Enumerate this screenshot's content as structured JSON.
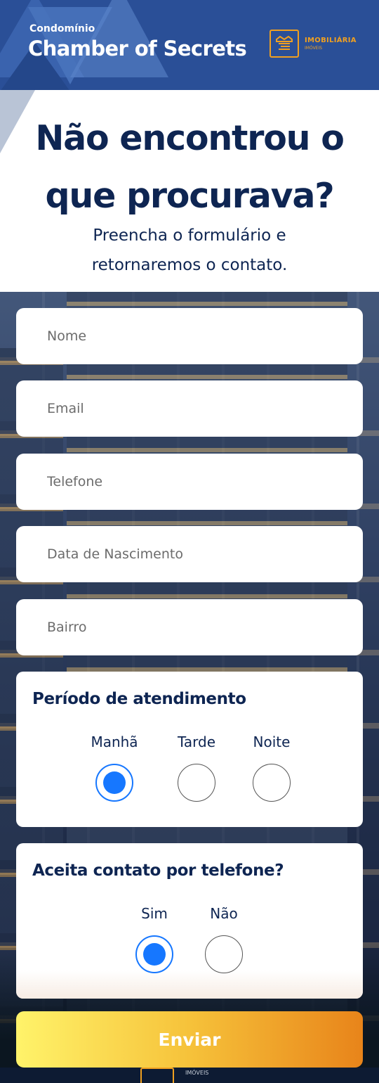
{
  "header": {
    "subtitle": "Condomínio",
    "title": "Chamber of Secrets",
    "logo": {
      "name": "IMOBILIÁRIA",
      "tagline": "IMÓVEIS",
      "icon": "crown-icon",
      "color": "#f0a020"
    },
    "background": "#2a4f97"
  },
  "intro": {
    "heading_line1": "Não encontrou o",
    "heading_line2": "que procurava?",
    "sub_line1": "Preencha o formulário e",
    "sub_line2": "retornaremos o contato."
  },
  "form": {
    "fields": {
      "nome": {
        "placeholder": "Nome",
        "value": ""
      },
      "email": {
        "placeholder": "Email",
        "value": ""
      },
      "telefone": {
        "placeholder": "Telefone",
        "value": ""
      },
      "nascimento": {
        "placeholder": "Data de Nascimento",
        "value": ""
      },
      "bairro": {
        "placeholder": "Bairro",
        "value": ""
      }
    },
    "periodo": {
      "title": "Período de atendimento",
      "options": [
        "Manhã",
        "Tarde",
        "Noite"
      ],
      "selected": "Manhã"
    },
    "contato": {
      "title": "Aceita contato por telefone?",
      "options": [
        "Sim",
        "Não"
      ],
      "selected": "Sim"
    },
    "submit_label": "Enviar"
  },
  "footer": {
    "tagline": "IMÓVEIS"
  },
  "colors": {
    "accent": "#1677ff",
    "heading": "#0e2552",
    "submit_start": "#fff36a",
    "submit_end": "#e8841a"
  }
}
